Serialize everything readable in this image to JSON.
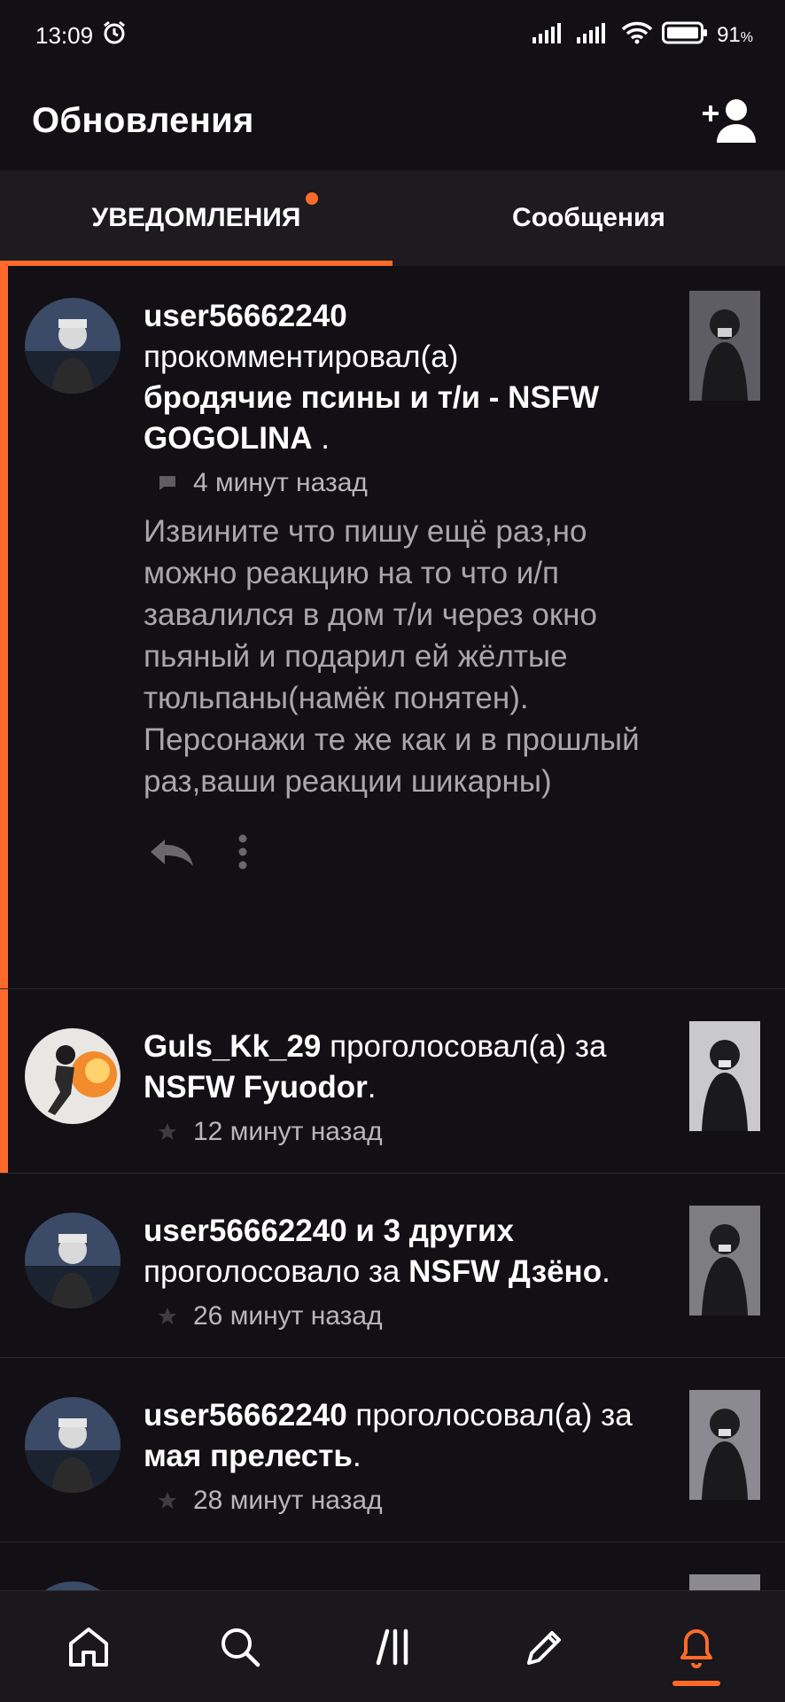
{
  "status_bar": {
    "time": "13:09",
    "battery_pct": "91",
    "battery_unit": "%"
  },
  "header": {
    "title": "Обновления"
  },
  "tabs": [
    {
      "label": "УВЕДОМЛЕНИЯ",
      "active": true,
      "has_dot": true
    },
    {
      "label": "Сообщения",
      "active": false
    }
  ],
  "notifications": [
    {
      "user": "user56662240",
      "action": "прокомментировал(а)",
      "target": "бродячие псины и т/и - NSFW GOGOLINA",
      "suffix": " .",
      "time": "4 минут назад",
      "comment": "Извините что пишу ещё раз,но можно реакцию на то что и/п завалился в дом т/и через окно пьяный и подарил ей жёлтые тюльпаны(намёк понятен).\nПерсонажи те же как и в прошлый раз,ваши реакции шикарны)"
    },
    {
      "user": "Guls_Kk_29",
      "action": " проголосовал(а) за ",
      "target": "NSFW Fyuodor",
      "suffix": ".",
      "time": "12 минут назад"
    },
    {
      "user": "user56662240 и 3 других",
      "action": "проголосовало за ",
      "target": "NSFW Дзёно",
      "suffix": ".",
      "time": "26 минут назад"
    },
    {
      "user": "user56662240",
      "action": " проголосовал(а) за ",
      "target": "мая прелесть",
      "suffix": ".",
      "time": "28 минут назад"
    }
  ],
  "colors": {
    "accent": "#ff6a2b",
    "background": "#121014",
    "surface": "#1d1b1f"
  }
}
